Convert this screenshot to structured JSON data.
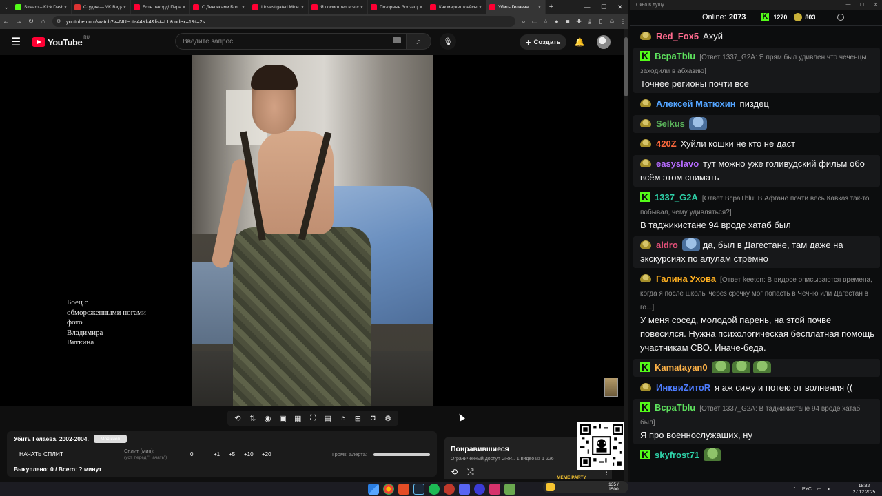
{
  "browser": {
    "tabs": [
      {
        "title": "Stream – Kick Dashboard",
        "favicon": "kick",
        "active": false
      },
      {
        "title": "Студия — VK Видео",
        "favicon": "vk",
        "active": false
      },
      {
        "title": "Есть рекорд! Перед",
        "favicon": "youtube",
        "active": false
      },
      {
        "title": "С Девочками Бол",
        "favicon": "youtube",
        "active": false
      },
      {
        "title": "I Investigated Mine",
        "favicon": "youtube",
        "active": false
      },
      {
        "title": "Я посмотрел все с",
        "favicon": "youtube",
        "active": false
      },
      {
        "title": "Позорные Зоозащ",
        "favicon": "youtube",
        "active": false
      },
      {
        "title": "Как маркетплейсы",
        "favicon": "youtube",
        "active": false
      },
      {
        "title": "Убить Гелаева",
        "favicon": "youtube",
        "active": true
      }
    ],
    "url": "youtube.com/watch?v=NUeota44Kk4&list=LL&index=1&t=2s"
  },
  "youtube": {
    "logo_text": "YouTube",
    "region": "RU",
    "search_placeholder": "Введите запрос",
    "create_label": "Создать"
  },
  "video": {
    "caption": "Боец с\nобмороженными ногами\nфото\nВладимира\nВяткина"
  },
  "split_panel": {
    "title": "Убить Гелаева. 2002-2004.",
    "badge": "Моя кноп",
    "start_label": "НАЧАТЬ СПЛИТ",
    "split_label": "Сплит (мин):",
    "split_hint": "(уст. перед \"Начать\")",
    "options": [
      "0",
      "+1",
      "+5",
      "+10",
      "+20"
    ],
    "alert_label": "Громк. алерта:",
    "bought_label": "Выкуплено: 0 / Всего: ? минут"
  },
  "liked": {
    "title": "Понравившиеся",
    "subtitle": "Ограниченный доступ  GRP...   1 видео из 1 226"
  },
  "chat": {
    "window_title": "Окно в душу",
    "online_label": "Online:",
    "online_count": "2073",
    "kick_count": "1270",
    "points_count": "803",
    "messages": [
      {
        "badge": "pepe",
        "user": "Red_Fox5",
        "color": "#ff6b8e",
        "reply": "",
        "emotes": 0,
        "text": "Ахуй"
      },
      {
        "badge": "kick",
        "user": "ВсраТblu",
        "color": "#5ee35e",
        "reply": "[Ответ 1337_G2A: Я прям был удивлен что чеченцы заходили в абхазию]",
        "emotes": 0,
        "text": "Точнее регионы почти все"
      },
      {
        "badge": "pepe",
        "user": "Алексей Матюхин",
        "color": "#53a4ff",
        "reply": "",
        "emotes": 0,
        "text": "пиздец"
      },
      {
        "badge": "pepe",
        "user": "Selkus",
        "color": "#5ab25a",
        "reply": "",
        "emotes": 1,
        "emote_color": "blue",
        "text": ""
      },
      {
        "badge": "pepe",
        "user": "420Z",
        "color": "#ff6a3d",
        "reply": "",
        "emotes": 0,
        "text": "Хуйли кошки не кто не даст"
      },
      {
        "badge": "pepe",
        "user": "easyslavo",
        "color": "#b66bff",
        "reply": "",
        "emotes": 0,
        "text": "тут можно уже голивудский фильм обо всём этом снимать"
      },
      {
        "badge": "kick",
        "user": "1337_G2A",
        "color": "#2ed1a8",
        "reply": "[Ответ ВсраТblu: В Афгане почти весь Кавказ так-то побывал, чему удивляться?]",
        "emotes": 0,
        "text": "В таджикистане 94 вроде хатаб был"
      },
      {
        "badge": "pepe",
        "user": "aldro",
        "color": "#e6507a",
        "reply": "",
        "emotes": 1,
        "emote_color": "blue",
        "text": "да, был в Дагестане, там даже на экскурсиях по алулам стрёмно"
      },
      {
        "badge": "pepe",
        "user": "Галина Ухова",
        "color": "#ffb020",
        "reply": "[Ответ keeton: В видосе описываются времена, когда я после школы через срочку мог попасть в Чечню или Дагестан в го...]",
        "emotes": 0,
        "text": "У меня сосед, молодой парень, на этой почве повесился. Нужна психологическая бесплатная помощь участникам СВО. Иначе-беда."
      },
      {
        "badge": "kick",
        "user": "Kamatayan0",
        "color": "#ffb347",
        "reply": "",
        "emotes": 3,
        "emote_color": "green",
        "text": ""
      },
      {
        "badge": "pepe",
        "user": "ИнквиZитоR",
        "color": "#4d7cff",
        "reply": "",
        "emotes": 0,
        "text": "я аж сижу и потею от волнения (("
      },
      {
        "badge": "kick",
        "user": "ВсраТblu",
        "color": "#5ee35e",
        "reply": "[Ответ 1337_G2A: В таджикистане 94 вроде хатаб был]",
        "emotes": 0,
        "text": "Я про военнослужащих, ну"
      },
      {
        "badge": "kick",
        "user": "skyfrost71",
        "color": "#2ed1a8",
        "reply": "",
        "emotes": 1,
        "emote_color": "green",
        "text": ""
      }
    ]
  },
  "taskbar": {
    "memeparty_title": "MEME PARTY",
    "memeparty_count": "135 / 1500",
    "language": "РУС",
    "time": "18:32",
    "date": "27.12.2025"
  }
}
